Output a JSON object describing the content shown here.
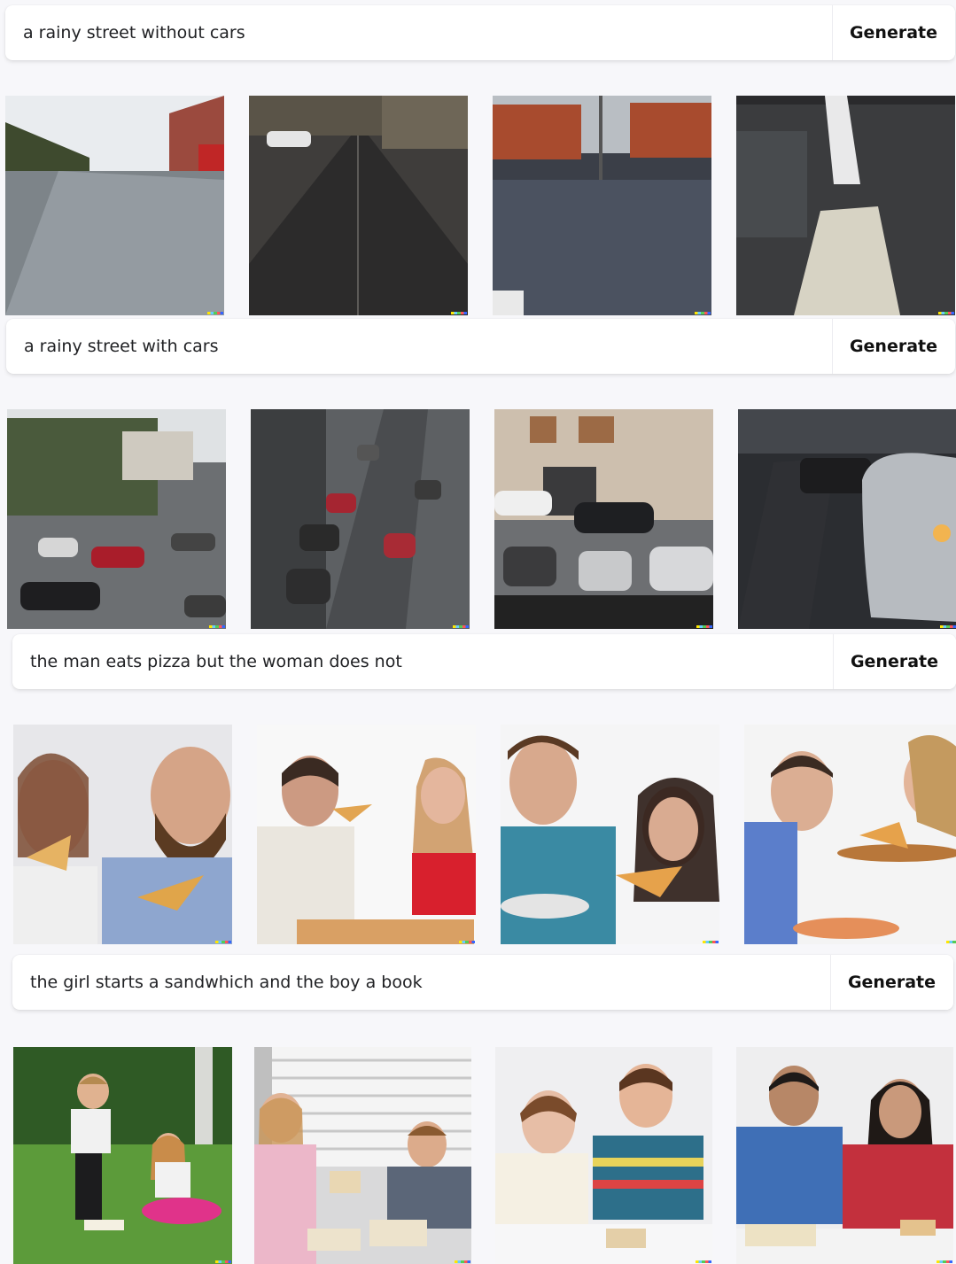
{
  "prompts": [
    {
      "text": "a rainy street without cars",
      "button": "Generate"
    },
    {
      "text": "a rainy street with cars",
      "button": "Generate"
    },
    {
      "text": "the man eats pizza but the woman does not",
      "button": "Generate"
    },
    {
      "text": "the girl starts a sandwhich and the boy a book",
      "button": "Generate"
    }
  ]
}
